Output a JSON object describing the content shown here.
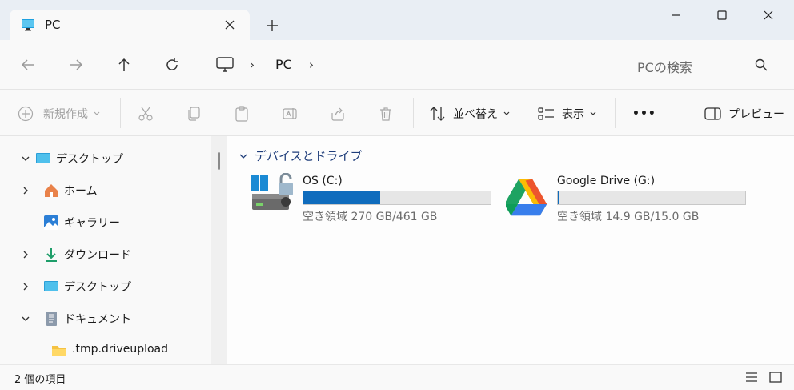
{
  "tab": {
    "title": "PC",
    "icon": "monitor-icon"
  },
  "window_controls": {
    "minimize": "─",
    "maximize": "☐",
    "close": "✕"
  },
  "address": {
    "breadcrumb_item": "PC",
    "search_placeholder": "PCの検索"
  },
  "toolbar": {
    "new_label": "新規作成",
    "sort_label": "並べ替え",
    "view_label": "表示",
    "more_label": "•••",
    "preview_label": "プレビュー"
  },
  "sidebar": {
    "items": [
      {
        "label": "デスクトップ",
        "expanded": true,
        "icon": "desktop-icon"
      },
      {
        "label": "ホーム",
        "expanded": false,
        "icon": "home-icon"
      },
      {
        "label": "ギャラリー",
        "icon": "gallery-icon"
      },
      {
        "label": "ダウンロード",
        "expanded": false,
        "icon": "download-icon"
      },
      {
        "label": "デスクトップ",
        "expanded": false,
        "icon": "desktop-icon"
      },
      {
        "label": "ドキュメント",
        "expanded": true,
        "icon": "document-icon"
      },
      {
        "label": ".tmp.driveupload",
        "icon": "folder-icon"
      }
    ]
  },
  "main": {
    "group_title": "デバイスとドライブ",
    "drives": [
      {
        "name": "OS (C:)",
        "free_text": "空き領域 270 GB/461 GB",
        "used_fraction": 0.41,
        "icon": "windows-drive-icon"
      },
      {
        "name": "Google Drive (G:)",
        "free_text": "空き領域 14.9 GB/15.0 GB",
        "used_fraction": 0.01,
        "icon": "google-drive-icon"
      }
    ]
  },
  "status": {
    "item_count": "2 個の項目"
  },
  "colors": {
    "accent": "#0f6cbd",
    "group_header": "#1f3d7a"
  }
}
